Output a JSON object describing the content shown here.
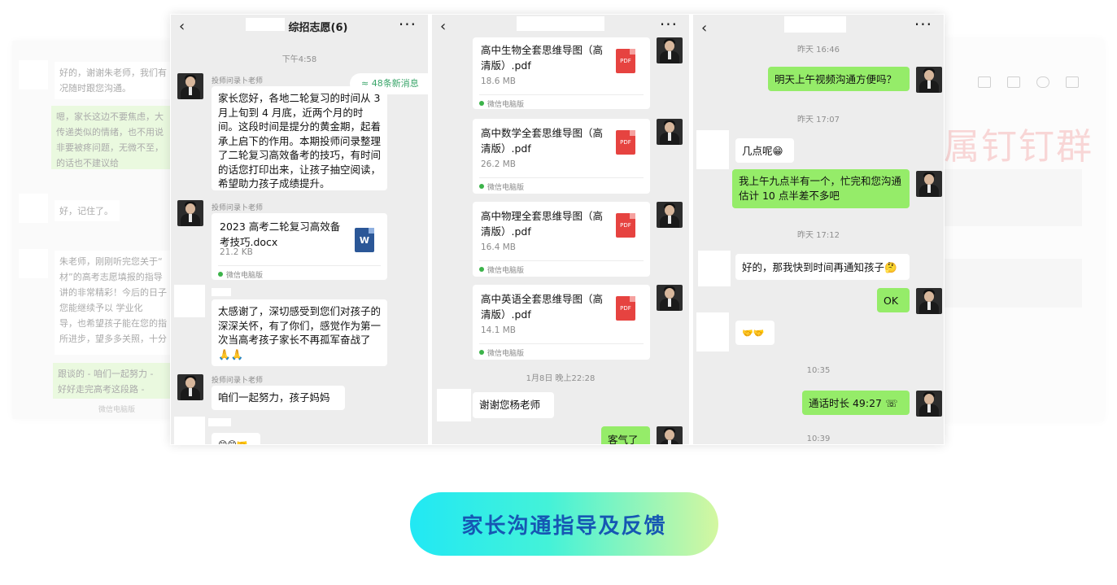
{
  "left_faded": {
    "lines": [
      "好的，谢谢朱老师，我们有",
      "况随时跟您沟通。"
    ],
    "green_lines": [
      "嗯，家长这边不要焦虑，大",
      "传递类似的情绪，也不用说",
      "非要被疼问题，无微不至，",
      "的话也不建议给"
    ],
    "short": "好，记住了。",
    "long_lines": [
      "朱老师，刚刚听完您关于“",
      "材”的高考志愿填报的指导",
      "讲的非常精彩！今后的日子",
      "您能继续予以        学业化",
      "导，也希望孩子能在您的指",
      "所进步，望多多关照，十分"
    ],
    "bottom_lines": [
      "跟谈的 - 咱们一起努力 -",
      "好好走完高考这段路 -"
    ],
    "footer": "微信电脑版"
  },
  "right_faded": {
    "big_text": "属钉钉群"
  },
  "panel1": {
    "title": "综招志愿(6)",
    "time_top": "下午4:58",
    "new_messages": "≈ 48条新消息",
    "sender": "投师问录卜老师",
    "msg1": "家长您好，各地二轮复习的时间从 3 月上旬到 4 月底，近两个月的时间。这段时间是提分的黄金期，起着承上启下的作用。本期投师问录整理了二轮复习高效备考的技巧，有时间的话您打印出来，让孩子抽空阅读，希望助力孩子成绩提升。",
    "sender2": "投师问录卜老师",
    "file_name": "2023 高考二轮复习高效备考技巧.docx",
    "file_size": "21.2 KB",
    "file_source": "微信电脑版",
    "msg2": "太感谢了，深切感受到您们对孩子的深深关怀，有了你们，感觉作为第一次当高考孩子家长不再孤军奋战了🙏🙏",
    "sender3": "投师问录卜老师",
    "msg3": "咱们一起努力，孩子妈妈",
    "msg4": "😊😊🤝"
  },
  "panel2": {
    "files": [
      {
        "name": "高中生物全套思维导图（高清版）.pdf",
        "size": "18.6 MB",
        "source": "微信电脑版"
      },
      {
        "name": "高中数学全套思维导图（高清版）.pdf",
        "size": "26.2 MB",
        "source": "微信电脑版"
      },
      {
        "name": "高中物理全套思维导图（高清版）.pdf",
        "size": "16.4 MB",
        "source": "微信电脑版"
      },
      {
        "name": "高中英语全套思维导图（高清版）.pdf",
        "size": "14.1 MB",
        "source": "微信电脑版"
      }
    ],
    "pdf_label": "PDF",
    "time": "1月8日 晚上22:28",
    "msg_thanks": "谢谢您杨老师",
    "msg_reply": "客气了"
  },
  "panel3": {
    "t1": "昨天 16:46",
    "m1": "明天上午视频沟通方便吗？",
    "t2": "昨天 17:07",
    "m2": "几点呢😁",
    "m3": "我上午九点半有一个，忙完和您沟通 估计 10 点半差不多吧",
    "t3": "昨天 17:12",
    "m4": "好的，那我快到时间再通知孩子🤔",
    "m5": "OK",
    "m6": "🤝🤝",
    "t4": "10:35",
    "m7": "通话时长 49:27 ☏",
    "t5": "10:39"
  },
  "cta": {
    "label": "家长沟通指导及反馈"
  },
  "colors": {
    "wechat_green": "#95ec69",
    "chat_bg": "#ededed",
    "pdf_red": "#e64340",
    "word_blue": "#2b5797",
    "cta_text": "#1657b3"
  }
}
